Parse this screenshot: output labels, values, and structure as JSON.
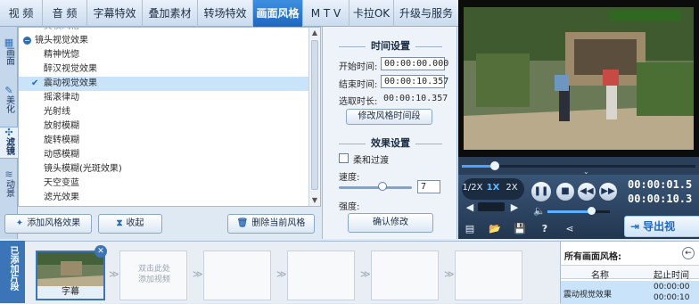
{
  "top_tabs": [
    "视 频",
    "音 频",
    "字幕特效",
    "叠加素材",
    "转场特效",
    "画面风格",
    "M T V",
    "卡拉OK",
    "升级与服务"
  ],
  "active_tab_index": 5,
  "left_tabs": [
    "画面",
    "美化",
    "滤镜",
    "动景"
  ],
  "effects": {
    "partial_top": "美妆风格",
    "group_label": "镜头视觉效果",
    "items": [
      "精神恍惚",
      "醉汉视觉效果",
      "震动视觉效果",
      "摇滚律动",
      "光射线",
      "放射模糊",
      "旋转模糊",
      "动感模糊",
      "镜头模糊(光斑效果)",
      "天空变蓝",
      "滤光效果"
    ],
    "selected_item": "震动视觉效果"
  },
  "buttons": {
    "add_style": "添加风格效果",
    "collapse": "收起",
    "delete_style": "删除当前风格",
    "confirm_edit": "确认修改",
    "modify_time": "修改风格时间段"
  },
  "time_settings": {
    "title": "时间设置",
    "start_label": "开始时间:",
    "start_value": "00:00:00.000",
    "end_label": "结束时间:",
    "end_value": "00:00:10.357",
    "duration_label": "选取时长:",
    "duration_value": "00:00:10.357"
  },
  "effect_settings": {
    "title": "效果设置",
    "soft_transition_label": "柔和过渡",
    "speed_label": "速度:",
    "speed_value": "7",
    "speed_fraction": 0.6,
    "strength_label": "强度:"
  },
  "player": {
    "speed_options": [
      "1/2X",
      "1X",
      "2X"
    ],
    "current_speed": "1X",
    "time_current": "00:00:01.5",
    "time_total": "00:00:10.3",
    "export_label": "导出视",
    "progress_fraction": 0.14,
    "volume_fraction": 0.7
  },
  "track": {
    "label": "已添加片段",
    "clip_label": "字幕",
    "empty_slot_text": "双击此处\n添加视频"
  },
  "styles_panel": {
    "title": "所有画面风格:",
    "col_name": "名称",
    "col_time": "起止时间",
    "row_name": "震动视觉效果",
    "row_start": "00:00:00",
    "row_end": "00:00:10"
  },
  "colors": {
    "accent_blue": "#1e67bf",
    "selection_bg": "#c9e3fb",
    "track_label_bg": "#3c75b7"
  }
}
